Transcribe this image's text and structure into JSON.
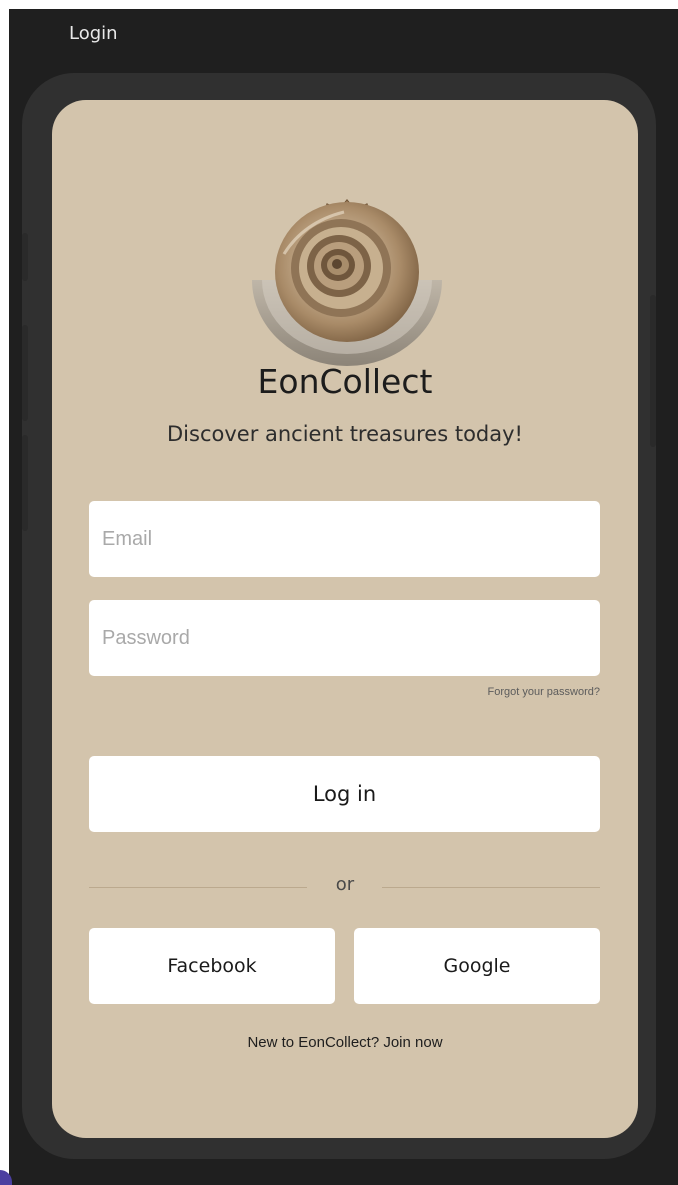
{
  "window": {
    "title": "Login"
  },
  "app": {
    "name": "EonCollect",
    "tagline": "Discover ancient treasures today!",
    "logo_icon": "ammonite-fossil-logo"
  },
  "form": {
    "email_placeholder": "Email",
    "email_value": "",
    "password_placeholder": "Password",
    "password_value": "",
    "forgot_label": "Forgot your password?",
    "login_label": "Log in"
  },
  "divider": {
    "label": "or"
  },
  "social": {
    "facebook_label": "Facebook",
    "google_label": "Google"
  },
  "signup": {
    "prompt": "New to EonCollect?",
    "link_label": "Join now"
  },
  "colors": {
    "screen_background": "#d3c4ac",
    "device_frame": "#303030",
    "window_background": "#1f1f1f",
    "button_background": "#ffffff"
  }
}
